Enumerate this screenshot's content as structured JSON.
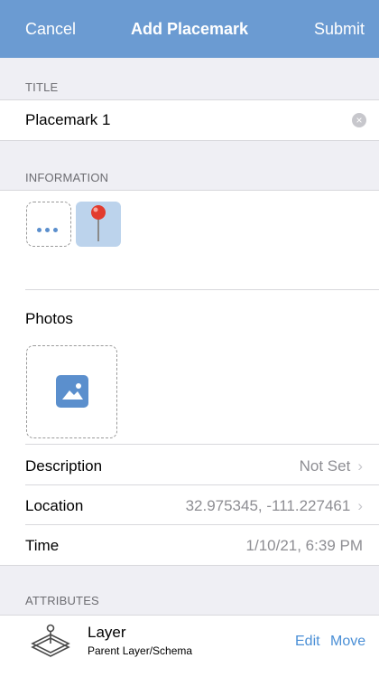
{
  "nav": {
    "cancel": "Cancel",
    "title": "Add Placemark",
    "submit": "Submit"
  },
  "title_section": {
    "header": "TITLE",
    "value": "Placemark 1",
    "placeholder": ""
  },
  "information": {
    "header": "INFORMATION",
    "icons": [
      "more-icon",
      "map-pin-icon"
    ]
  },
  "photos": {
    "label": "Photos",
    "icon": "image-icon"
  },
  "rows": {
    "description": {
      "label": "Description",
      "value": "Not Set"
    },
    "location": {
      "label": "Location",
      "value": "32.975345, -111.227461"
    },
    "time": {
      "label": "Time",
      "value": "1/10/21, 6:39 PM"
    }
  },
  "attributes": {
    "header": "ATTRIBUTES",
    "layer_name": "Layer",
    "layer_subtitle": "Parent Layer/Schema",
    "edit": "Edit",
    "move": "Move",
    "icon": "layer-stack-icon"
  },
  "colors": {
    "nav": "#6b9bd2",
    "accent": "#4a8fd6",
    "pin_bg": "#bcd3ec",
    "icon_blue": "#5b8fcd"
  }
}
